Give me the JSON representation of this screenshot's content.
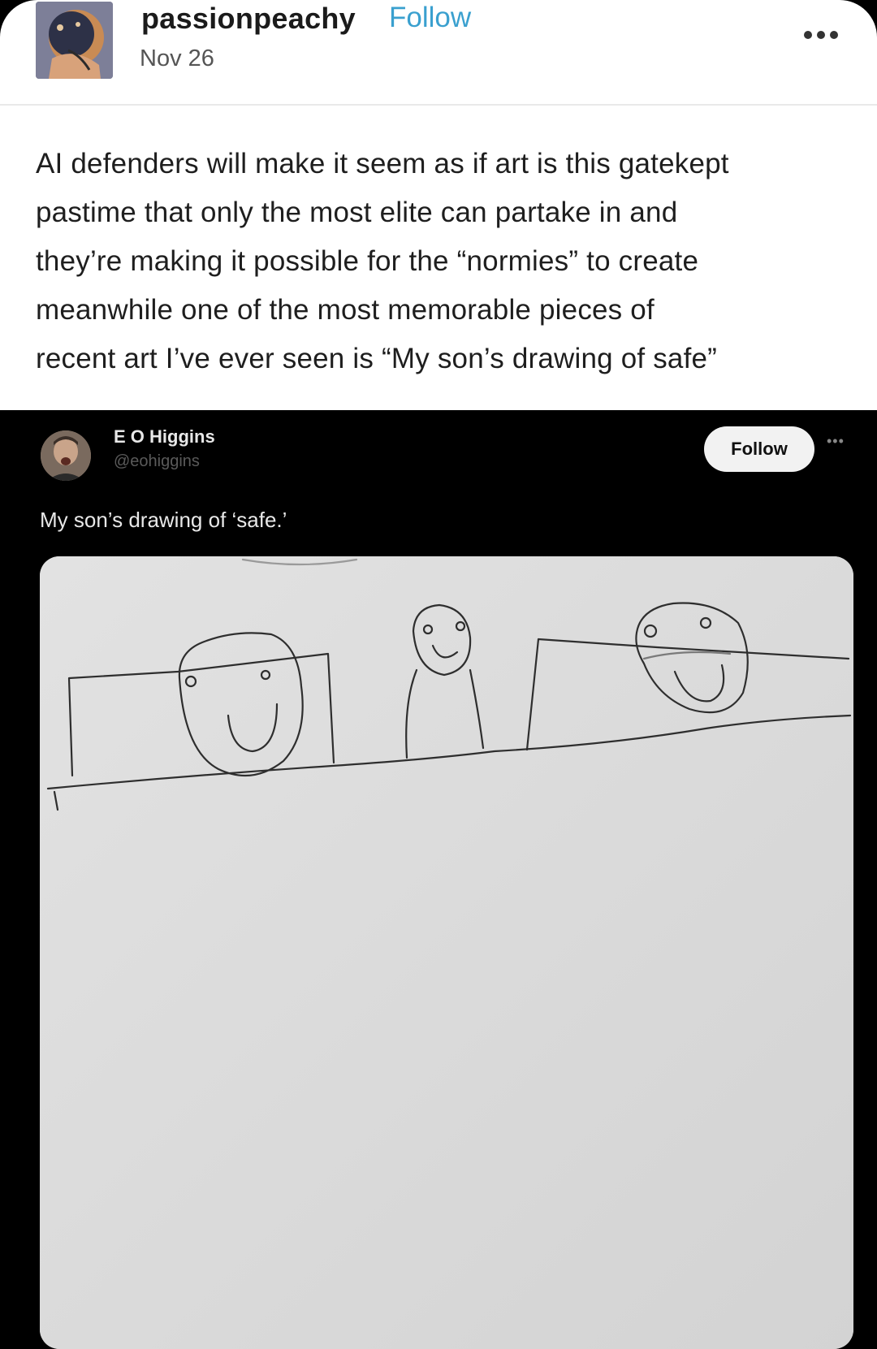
{
  "post": {
    "username": "passionpeachy",
    "follow_label": "Follow",
    "date": "Nov 26",
    "more_icon": "ellipsis-icon",
    "body_lines": [
      "AI defenders will make it seem as if art is this gatekept",
      "pastime that only the most elite can partake in and",
      "they’re making it possible for the “normies” to create",
      "meanwhile one of the most memorable pieces of",
      "recent art I’ve ever seen is “My son’s drawing of safe”"
    ]
  },
  "tweet": {
    "name": "E O Higgins",
    "handle": "@eohiggins",
    "follow_label": "Follow",
    "more_icon": "ellipsis-icon",
    "text": "My son’s drawing of ‘safe.’"
  },
  "colors": {
    "card_bg": "#ffffff",
    "follow_link": "#3aa0cf",
    "tweet_bg": "#000000",
    "drawing_paper": "#dcdcdc"
  }
}
